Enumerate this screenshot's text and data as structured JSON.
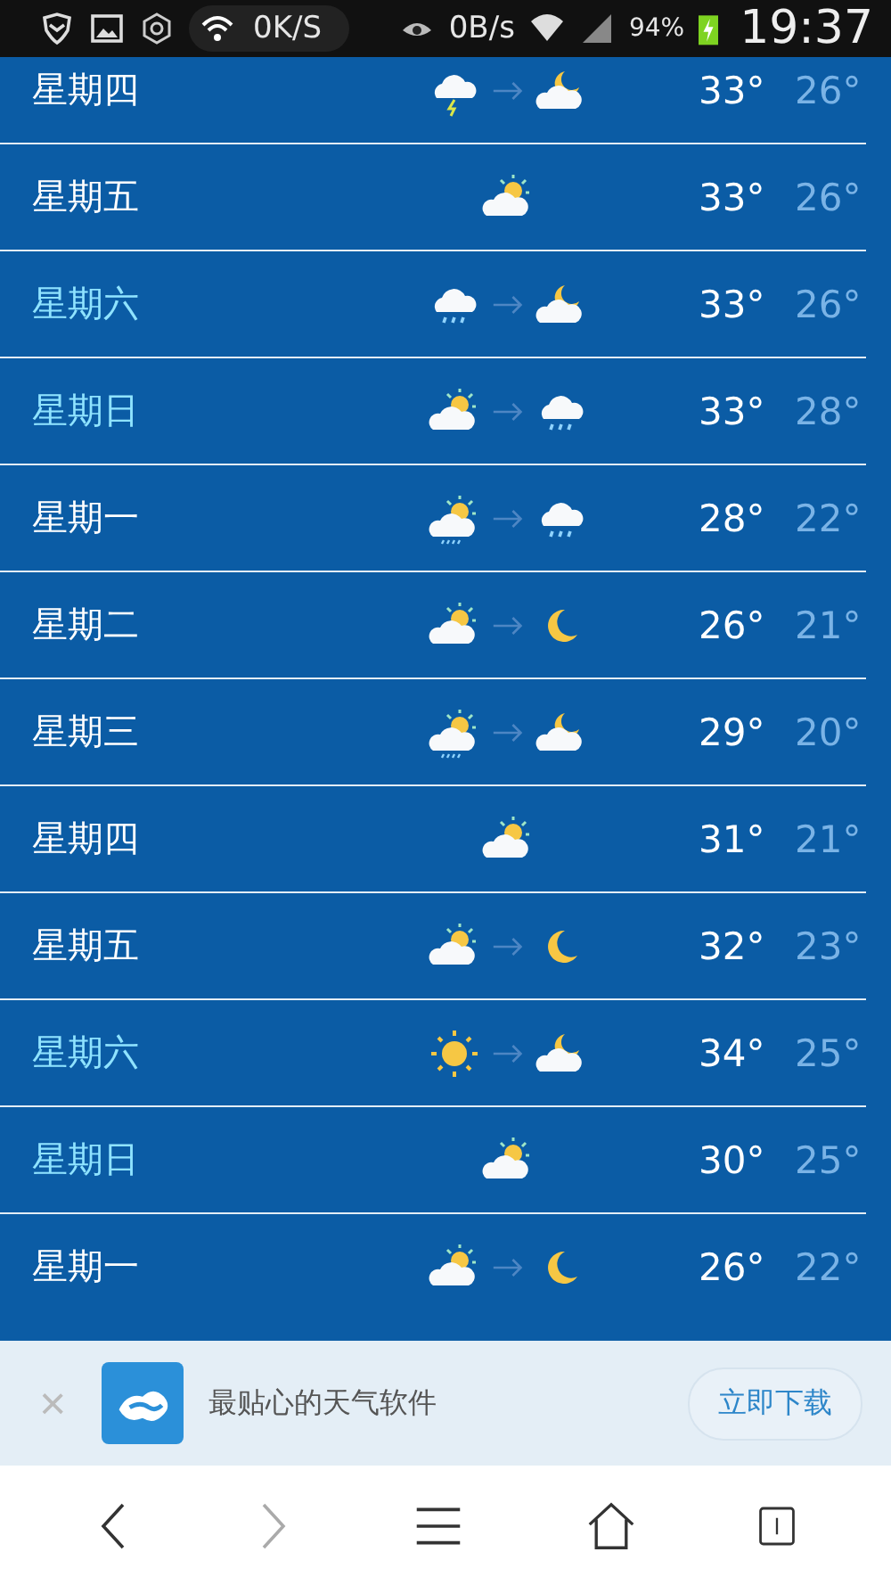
{
  "status_bar": {
    "speed": "0K/S",
    "data_rate": "0B/s",
    "battery": "94%",
    "time": "19:37"
  },
  "forecast": [
    {
      "day": "星期四",
      "color": "#ffffff",
      "icons": [
        {
          "kind": "thunder"
        },
        {
          "kind": "moon-cloud"
        }
      ],
      "high": "33°",
      "low": "26°"
    },
    {
      "day": "星期五",
      "color": "#ffffff",
      "icons": [
        {
          "kind": "sun-cloud"
        }
      ],
      "high": "33°",
      "low": "26°"
    },
    {
      "day": "星期六",
      "color": "#8fe3ff",
      "icons": [
        {
          "kind": "rain"
        },
        {
          "kind": "moon-cloud"
        }
      ],
      "high": "33°",
      "low": "26°"
    },
    {
      "day": "星期日",
      "color": "#8fe3ff",
      "icons": [
        {
          "kind": "sun-cloud"
        },
        {
          "kind": "rain"
        }
      ],
      "high": "33°",
      "low": "28°"
    },
    {
      "day": "星期一",
      "color": "#ffffff",
      "icons": [
        {
          "kind": "sun-rain"
        },
        {
          "kind": "rain"
        }
      ],
      "high": "28°",
      "low": "22°"
    },
    {
      "day": "星期二",
      "color": "#ffffff",
      "icons": [
        {
          "kind": "sun-cloud"
        },
        {
          "kind": "moon"
        }
      ],
      "high": "26°",
      "low": "21°"
    },
    {
      "day": "星期三",
      "color": "#ffffff",
      "icons": [
        {
          "kind": "sun-rain"
        },
        {
          "kind": "moon-cloud"
        }
      ],
      "high": "29°",
      "low": "20°"
    },
    {
      "day": "星期四",
      "color": "#ffffff",
      "icons": [
        {
          "kind": "sun-cloud"
        }
      ],
      "high": "31°",
      "low": "21°"
    },
    {
      "day": "星期五",
      "color": "#ffffff",
      "icons": [
        {
          "kind": "sun-cloud"
        },
        {
          "kind": "moon"
        }
      ],
      "high": "32°",
      "low": "23°"
    },
    {
      "day": "星期六",
      "color": "#8fe3ff",
      "icons": [
        {
          "kind": "sun"
        },
        {
          "kind": "moon-cloud"
        }
      ],
      "high": "34°",
      "low": "25°"
    },
    {
      "day": "星期日",
      "color": "#8fe3ff",
      "icons": [
        {
          "kind": "sun-cloud"
        }
      ],
      "high": "30°",
      "low": "25°"
    },
    {
      "day": "星期一",
      "color": "#ffffff",
      "icons": [
        {
          "kind": "sun-cloud"
        },
        {
          "kind": "moon"
        }
      ],
      "high": "26°",
      "low": "22°"
    }
  ],
  "ad_banner": {
    "close": "×",
    "text": "最贴心的天气软件",
    "button": "立即下载"
  }
}
